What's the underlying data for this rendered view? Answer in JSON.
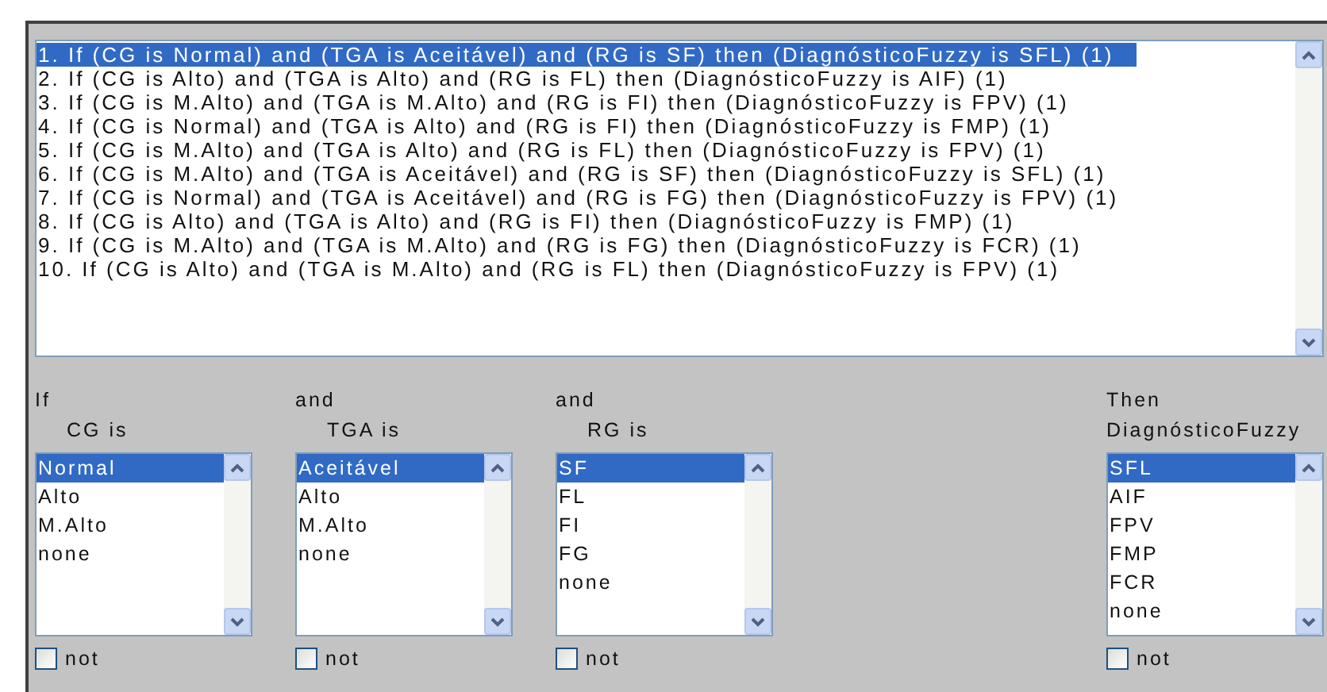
{
  "rules": [
    {
      "text": "1. If (CG is Normal) and (TGA is Aceitável) and (RG is SF) then (DiagnósticoFuzzy is SFL) (1)",
      "selected": true
    },
    {
      "text": "2. If (CG is Alto) and (TGA is Alto) and (RG is FL) then (DiagnósticoFuzzy is AIF) (1)",
      "selected": false
    },
    {
      "text": "3. If (CG is M.Alto) and (TGA is M.Alto) and (RG is FI) then (DiagnósticoFuzzy is FPV) (1)",
      "selected": false
    },
    {
      "text": "4. If (CG is Normal) and (TGA is Alto) and (RG is FI) then (DiagnósticoFuzzy is FMP) (1)",
      "selected": false
    },
    {
      "text": "5. If (CG is M.Alto) and (TGA is Alto) and (RG is FL) then (DiagnósticoFuzzy is FPV) (1)",
      "selected": false
    },
    {
      "text": "6. If (CG is M.Alto) and (TGA is Aceitável) and (RG is SF) then (DiagnósticoFuzzy is SFL) (1)",
      "selected": false
    },
    {
      "text": "7. If (CG is Normal) and (TGA is Aceitável) and (RG is FG) then (DiagnósticoFuzzy is FPV) (1)",
      "selected": false
    },
    {
      "text": "8. If (CG is Alto) and (TGA is Alto) and (RG is FI) then (DiagnósticoFuzzy is FMP) (1)",
      "selected": false
    },
    {
      "text": "9. If (CG is M.Alto) and (TGA is M.Alto) and (RG is FG) then (DiagnósticoFuzzy is FCR) (1)",
      "selected": false
    },
    {
      "text": "10. If (CG is Alto) and (TGA is M.Alto) and (RG is FL) then (DiagnósticoFuzzy is FPV) (1)",
      "selected": false
    }
  ],
  "variables": [
    {
      "kind": "input",
      "connector": "If",
      "label": "CG is",
      "not": {
        "label": "not",
        "checked": false
      },
      "options": [
        {
          "label": "Normal",
          "selected": true
        },
        {
          "label": "Alto",
          "selected": false
        },
        {
          "label": "M.Alto",
          "selected": false
        },
        {
          "label": "none",
          "selected": false
        }
      ]
    },
    {
      "kind": "input",
      "connector": "and",
      "label": "TGA is",
      "not": {
        "label": "not",
        "checked": false
      },
      "options": [
        {
          "label": "Aceitável",
          "selected": true
        },
        {
          "label": "Alto",
          "selected": false
        },
        {
          "label": "M.Alto",
          "selected": false
        },
        {
          "label": "none",
          "selected": false
        }
      ]
    },
    {
      "kind": "input",
      "connector": "and",
      "label": "RG is",
      "not": {
        "label": "not",
        "checked": false
      },
      "options": [
        {
          "label": "SF",
          "selected": true
        },
        {
          "label": "FL",
          "selected": false
        },
        {
          "label": "FI",
          "selected": false
        },
        {
          "label": "FG",
          "selected": false
        },
        {
          "label": "none",
          "selected": false
        }
      ]
    },
    {
      "kind": "output",
      "connector": "Then",
      "label": "DiagnósticoFuzzy",
      "not": {
        "label": "not",
        "checked": false
      },
      "options": [
        {
          "label": "SFL",
          "selected": true
        },
        {
          "label": "AIF",
          "selected": false
        },
        {
          "label": "FPV",
          "selected": false
        },
        {
          "label": "FMP",
          "selected": false
        },
        {
          "label": "FCR",
          "selected": false
        },
        {
          "label": "none",
          "selected": false
        }
      ]
    }
  ]
}
